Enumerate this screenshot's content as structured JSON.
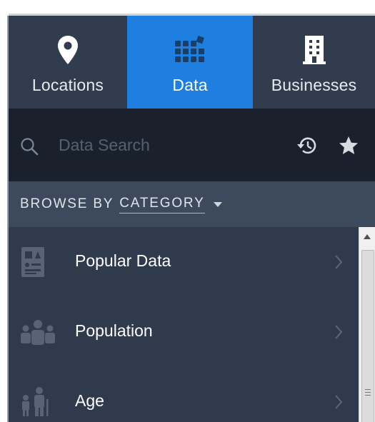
{
  "tabs": [
    {
      "label": "Locations",
      "icon": "location-pin-icon",
      "active": false
    },
    {
      "label": "Data",
      "icon": "data-grid-icon",
      "active": true
    },
    {
      "label": "Businesses",
      "icon": "building-icon",
      "active": false
    }
  ],
  "search": {
    "placeholder": "Data Search",
    "value": ""
  },
  "browse": {
    "prefix": "BROWSE BY",
    "category": "CATEGORY"
  },
  "items": [
    {
      "label": "Popular Data",
      "icon": "document-chart-icon"
    },
    {
      "label": "Population",
      "icon": "people-group-icon"
    },
    {
      "label": "Age",
      "icon": "family-age-icon"
    }
  ],
  "colors": {
    "active_tab": "#1e7fe0",
    "panel": "#2f3a4c",
    "search_bg": "#1b212c",
    "browse_bg": "#3d4a5e"
  }
}
